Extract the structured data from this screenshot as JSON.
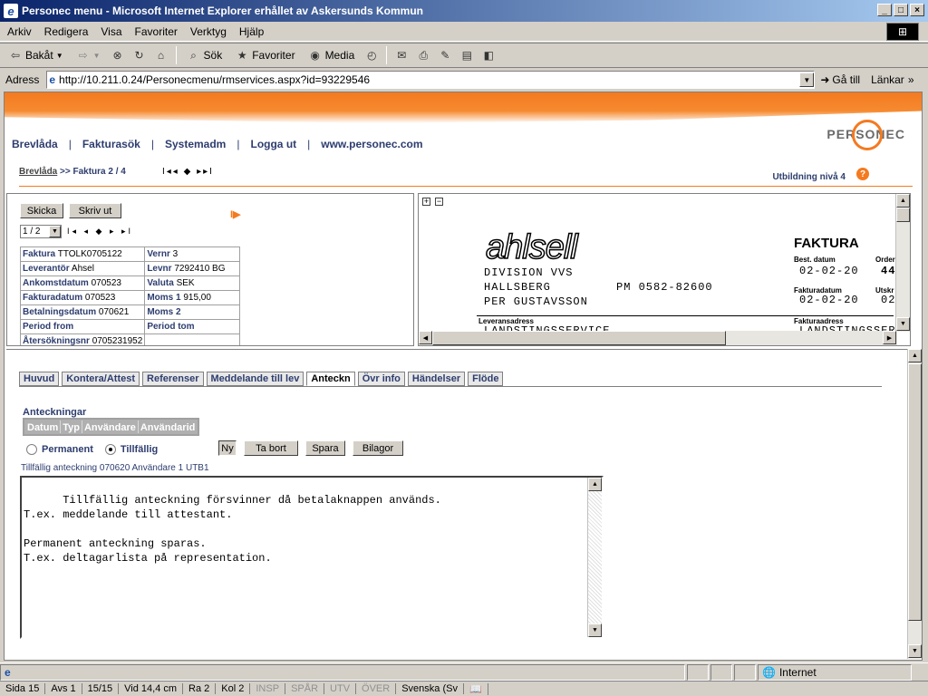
{
  "window": {
    "title": "Personec menu - Microsoft Internet Explorer erhållet av Askersunds Kommun",
    "controls": [
      "_",
      "□",
      "×"
    ]
  },
  "menu": [
    "Arkiv",
    "Redigera",
    "Visa",
    "Favoriter",
    "Verktyg",
    "Hjälp"
  ],
  "toolbar": {
    "back": "Bakåt",
    "search": "Sök",
    "favorites": "Favoriter",
    "media": "Media"
  },
  "address": {
    "label": "Adress",
    "url": "http://10.211.0.24/Personecmenu/rmservices.aspx?id=93229546",
    "go": "Gå till",
    "links": "Länkar"
  },
  "nav": {
    "items": [
      "Brevlåda",
      "Fakturasök",
      "Systemadm",
      "Logga ut",
      "www.personec.com"
    ],
    "logo": "PERSONEC"
  },
  "breadcrumb": {
    "link": "Brevlåda",
    "current": ">> Faktura 2 / 4",
    "controls": "I◂◂ ◆ ▸▸I"
  },
  "level": "Utbildning nivå 4",
  "help": "?",
  "invoice_panel": {
    "send": "Skicka",
    "print": "Skriv ut",
    "page": "1 / 2",
    "page_controls": "I◂ ◂ ◆ ▸ ▸I",
    "fields": [
      {
        "label": "Faktura",
        "value": "TTOLK0705122",
        "label2": "Vernr",
        "value2": "3"
      },
      {
        "label": "Leverantör",
        "value": "Ahsel",
        "label2": "Levnr",
        "value2": "7292410 BG"
      },
      {
        "label": "Ankomstdatum",
        "value": "070523",
        "label2": "Valuta",
        "value2": "SEK"
      },
      {
        "label": "Fakturadatum",
        "value": "070523",
        "label2": "Moms 1",
        "value2": "915,00"
      },
      {
        "label": "Betalningsdatum",
        "value": "070621",
        "label2": "Moms 2",
        "value2": ""
      },
      {
        "label": "Period from",
        "value": "",
        "label2": "Period tom",
        "value2": ""
      },
      {
        "label": "Återsökningsnr",
        "value": "0705231952",
        "label2": "",
        "value2": ""
      }
    ]
  },
  "scan": {
    "brand": "ahlsell",
    "lines": [
      "DIVISION VVS",
      "HALLSBERG",
      "PER GUSTAVSSON"
    ],
    "phone": "PM 0582-82600",
    "title": "FAKTURA",
    "best_label": "Best. datum",
    "best_date": "02-02-20",
    "order_label": "Order",
    "order_value": "44",
    "faktdat_label": "Fakturadatum",
    "faktdat_value": "02-02-20",
    "utskr_label": "Utskr",
    "utskr_value": "02",
    "leverans_label": "Leveransadress",
    "leverans_value": "LANDSTINGSSERVICE",
    "fakturaadr_label": "Fakturaadress",
    "fakturaadr_value": "LANDSTINGSSER"
  },
  "tabs": [
    "Huvud",
    "Kontera/Attest",
    "Referenser",
    "Meddelande till lev",
    "Anteckn",
    "Övr info",
    "Händelser",
    "Flöde"
  ],
  "active_tab": "Anteckn",
  "notes": {
    "title": "Anteckningar",
    "columns": [
      "Datum",
      "Typ",
      "Användare",
      "Användarid"
    ],
    "radio_permanent": "Permanent",
    "radio_temp": "Tillfällig",
    "btn_new": "Ny",
    "btn_delete": "Ta bort",
    "btn_save": "Spara",
    "btn_attach": "Bilagor",
    "info": "Tillfällig anteckning 070620 Användare 1 UTB1",
    "text": "Tillfällig anteckning försvinner då betalaknappen används.\nT.ex. meddelande till attestant.\n\nPermanent anteckning sparas.\nT.ex. deltagarlista på representation."
  },
  "status": {
    "zone": "Internet"
  },
  "word_status": {
    "sida": "Sida  15",
    "avs": "Avs  1",
    "pages": "15/15",
    "vid": "Vid  14,4 cm",
    "ra": "Ra  2",
    "kol": "Kol  2",
    "insp": "INSP",
    "spar": "SPÅR",
    "utv": "UTV",
    "over": "ÖVER",
    "lang": "Svenska (Sv"
  }
}
